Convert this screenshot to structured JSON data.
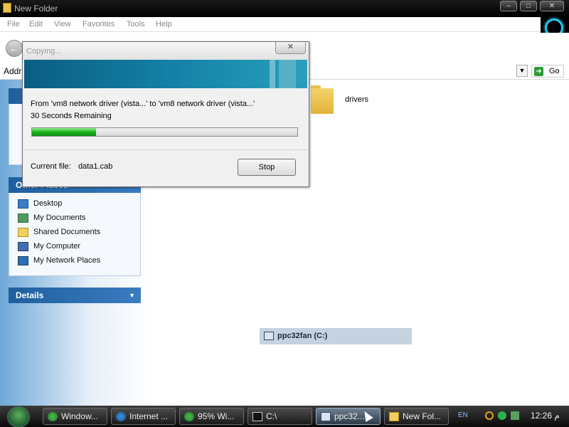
{
  "window": {
    "title": "New Folder",
    "minimize_icon": "minimize-icon",
    "maximize_icon": "maximize-icon",
    "close_icon": "close-icon"
  },
  "menu": [
    "File",
    "Edit",
    "View",
    "Favorites",
    "Tools",
    "Help"
  ],
  "address": {
    "label": "Addr",
    "go_label": "Go"
  },
  "task_pane": {
    "other_places_title": "Other Places",
    "places": [
      {
        "label": "Desktop",
        "icon": "desktop-icon"
      },
      {
        "label": "My Documents",
        "icon": "my-documents-icon"
      },
      {
        "label": "Shared Documents",
        "icon": "shared-documents-icon"
      },
      {
        "label": "My Computer",
        "icon": "my-computer-icon"
      },
      {
        "label": "My Network Places",
        "icon": "network-places-icon"
      }
    ],
    "details_title": "Details"
  },
  "content": {
    "folder_label": "drivers",
    "drive_label": "ppc32fan (C:)"
  },
  "copy_dialog": {
    "title": "Copying...",
    "from_text": "From 'vm8 network driver (vista...' to 'vm8 network driver (vista...'",
    "remaining": "30 Seconds Remaining",
    "progress": 0.24,
    "current_file_label": "Current file:",
    "current_file": "data1.cab",
    "stop_label": "Stop"
  },
  "taskbar": {
    "items": [
      {
        "label": "Window...",
        "icon": "ie-green-icon"
      },
      {
        "label": "Internet ...",
        "icon": "ie-icon"
      },
      {
        "label": "95% Wi...",
        "icon": "ie-green-icon"
      },
      {
        "label": "C:\\",
        "icon": "cmd-icon"
      },
      {
        "label": "ppc32...",
        "icon": "drive-icon",
        "active": true
      },
      {
        "label": "New Fol...",
        "icon": "folder-icon"
      }
    ],
    "language": "EN",
    "clock": "12:26 م"
  }
}
